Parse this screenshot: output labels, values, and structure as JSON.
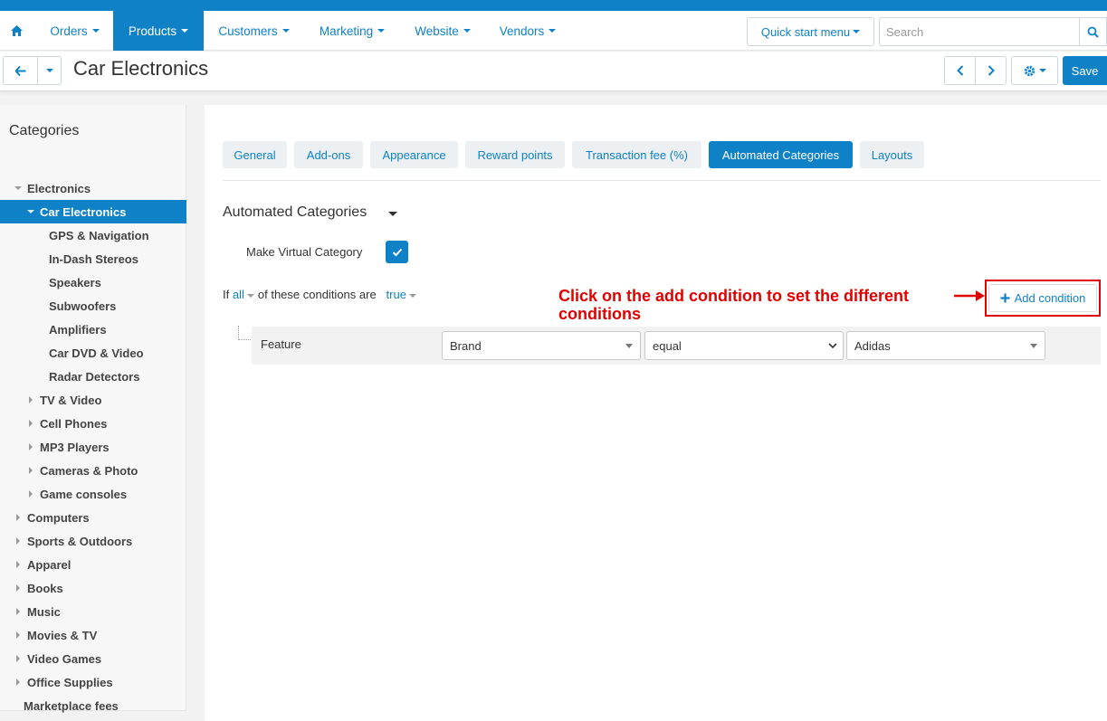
{
  "nav": {
    "items": [
      {
        "label": "Orders",
        "active": false
      },
      {
        "label": "Products",
        "active": true
      },
      {
        "label": "Customers",
        "active": false
      },
      {
        "label": "Marketing",
        "active": false
      },
      {
        "label": "Website",
        "active": false
      },
      {
        "label": "Vendors",
        "active": false
      }
    ],
    "quick_start": "Quick start menu",
    "search_placeholder": "Search"
  },
  "toolbar": {
    "title": "Car Electronics",
    "save_label": "Save"
  },
  "sidebar": {
    "title": "Categories",
    "categories": [
      {
        "label": "Electronics",
        "level": 0,
        "expander": "down"
      },
      {
        "label": "Car Electronics",
        "level": 1,
        "expander": "down",
        "active": true
      },
      {
        "label": "GPS & Navigation",
        "level": 2
      },
      {
        "label": "In-Dash Stereos",
        "level": 2
      },
      {
        "label": "Speakers",
        "level": 2
      },
      {
        "label": "Subwoofers",
        "level": 2
      },
      {
        "label": "Amplifiers",
        "level": 2
      },
      {
        "label": "Car DVD & Video",
        "level": 2
      },
      {
        "label": "Radar Detectors",
        "level": 2
      },
      {
        "label": "TV & Video",
        "level": 1,
        "expander": "right"
      },
      {
        "label": "Cell Phones",
        "level": 1,
        "expander": "right"
      },
      {
        "label": "MP3 Players",
        "level": 1,
        "expander": "right"
      },
      {
        "label": "Cameras & Photo",
        "level": 1,
        "expander": "right"
      },
      {
        "label": "Game consoles",
        "level": 1,
        "expander": "right"
      },
      {
        "label": "Computers",
        "level": 0,
        "expander": "right"
      },
      {
        "label": "Sports & Outdoors",
        "level": 0,
        "expander": "right"
      },
      {
        "label": "Apparel",
        "level": 0,
        "expander": "right"
      },
      {
        "label": "Books",
        "level": 0,
        "expander": "right"
      },
      {
        "label": "Music",
        "level": 0,
        "expander": "right"
      },
      {
        "label": "Movies & TV",
        "level": 0,
        "expander": "right"
      },
      {
        "label": "Video Games",
        "level": 0,
        "expander": "right"
      },
      {
        "label": "Office Supplies",
        "level": 0,
        "expander": "right"
      },
      {
        "label": "Marketplace fees",
        "level": 0
      }
    ]
  },
  "tabs": [
    {
      "label": "General",
      "active": false
    },
    {
      "label": "Add-ons",
      "active": false
    },
    {
      "label": "Appearance",
      "active": false
    },
    {
      "label": "Reward points",
      "active": false
    },
    {
      "label": "Transaction fee (%)",
      "active": false
    },
    {
      "label": "Automated Categories",
      "active": true
    },
    {
      "label": "Layouts",
      "active": false
    }
  ],
  "automated": {
    "section_title": "Automated Categories",
    "virtual_label": "Make Virtual Category",
    "virtual_checked": true,
    "cond_if": "If",
    "cond_all": "all",
    "cond_mid": "of these conditions are",
    "cond_true": "true",
    "add_condition": "Add condition",
    "annotation": "Click on the add condition to set the different conditions",
    "condition": {
      "label": "Feature",
      "feature": "Brand",
      "operator": "equal",
      "value": "Adidas"
    }
  },
  "colors": {
    "accent": "#0f81c7",
    "annotation": "#e00000"
  }
}
